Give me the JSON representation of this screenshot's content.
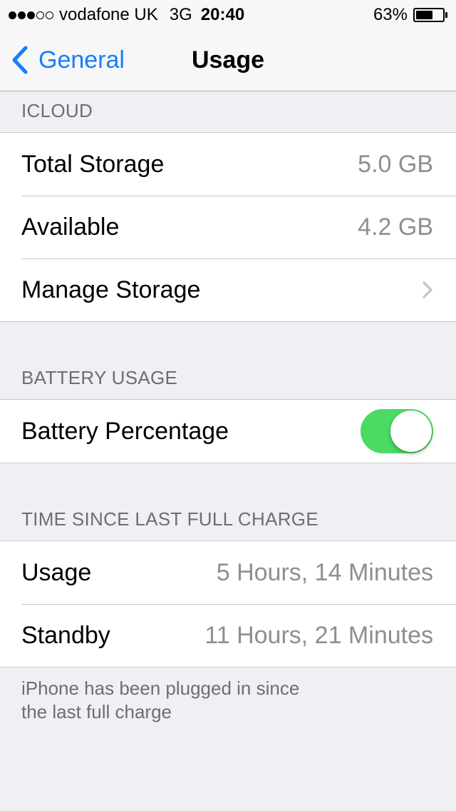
{
  "status_bar": {
    "signal_bars_filled": 3,
    "signal_bars_total": 5,
    "carrier": "vodafone UK",
    "network": "3G",
    "time": "20:40",
    "battery_percent_text": "63%",
    "battery_level": 0.63
  },
  "nav": {
    "back_label": "General",
    "title": "Usage"
  },
  "icloud": {
    "header": "ICLOUD",
    "rows": [
      {
        "label": "Total Storage",
        "value": "5.0 GB"
      },
      {
        "label": "Available",
        "value": "4.2 GB"
      },
      {
        "label": "Manage Storage"
      }
    ]
  },
  "battery_usage": {
    "header": "BATTERY USAGE",
    "battery_percentage_label": "Battery Percentage",
    "battery_percentage_on": true
  },
  "time_since_charge": {
    "header": "TIME SINCE LAST FULL CHARGE",
    "rows": [
      {
        "label": "Usage",
        "value": "5 Hours, 14 Minutes"
      },
      {
        "label": "Standby",
        "value": "11 Hours, 21 Minutes"
      }
    ],
    "footer": "iPhone has been plugged in since the last full charge"
  },
  "colors": {
    "accent": "#147efb",
    "toggle_on": "#4cd964",
    "background": "#efeff4",
    "secondary_text": "#8e8e93",
    "header_text": "#6d6d72"
  },
  "icons": {
    "back": "chevron-left-icon",
    "disclosure": "chevron-right-icon",
    "signal": "signal-dots-icon",
    "battery": "battery-icon"
  }
}
